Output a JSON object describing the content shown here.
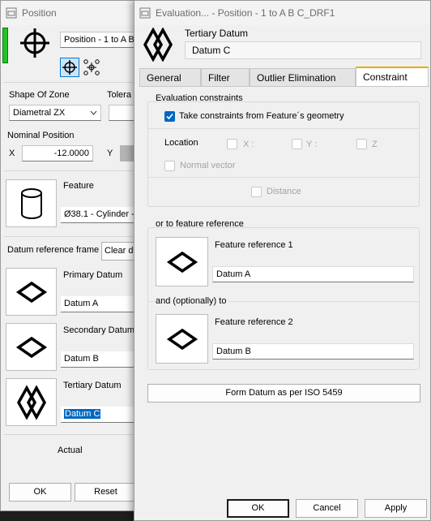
{
  "bg_window": {
    "title": "Position",
    "datum_name_input": "Position - 1 to A B",
    "shape_of_zone_label": "Shape Of Zone",
    "tolerance_label": "Tolera",
    "shape_select": "Diametral ZX",
    "nominal_position_label": "Nominal Position",
    "x_label": "X",
    "x_value": "-12.0000",
    "y_label": "Y",
    "feature_label": "Feature",
    "feature_value": "Ø38.1 - Cylinder -",
    "datum_ref_frame_label": "Datum reference frame",
    "clear_button": "Clear da",
    "primary_label": "Primary Datum",
    "primary_value": "Datum A",
    "secondary_label": "Secondary Datum",
    "secondary_value": "Datum B",
    "tertiary_label": "Tertiary Datum",
    "tertiary_value": "Datum C",
    "actual_label": "Actual",
    "ok_button": "OK",
    "reset_button": "Reset"
  },
  "dialog": {
    "title": "Evaluation... - Position - 1 to A B C_DRF1",
    "header_label": "Tertiary Datum",
    "header_value": "Datum C",
    "tabs": [
      {
        "label": "General",
        "active": false
      },
      {
        "label": "Filter",
        "active": false
      },
      {
        "label": "Outlier Elimination",
        "active": false
      },
      {
        "label": "Constraint",
        "active": true
      }
    ],
    "evaluation_constraints_title": "Evaluation constraints",
    "take_constraints_label": "Take constraints from Feature´s geometry",
    "take_constraints_checked": true,
    "location_label": "Location",
    "x_label": "X :",
    "y_label": "Y :",
    "z_label": "Z",
    "normal_vector_label": "Normal vector",
    "distance_label": "Distance",
    "or_feature_ref_title": "or to feature reference",
    "feature_ref1_label": "Feature reference 1",
    "feature_ref1_value": "Datum A",
    "and_optionally_title": "and (optionally) to",
    "feature_ref2_label": "Feature reference 2",
    "feature_ref2_value": "Datum B",
    "form_datum_button": "Form Datum as per ISO 5459",
    "ok_button": "OK",
    "cancel_button": "Cancel",
    "apply_button": "Apply"
  },
  "colors": {
    "accent_tab": "#f0a800",
    "checkbox": "#0067c0",
    "status_green": "#22c322"
  }
}
